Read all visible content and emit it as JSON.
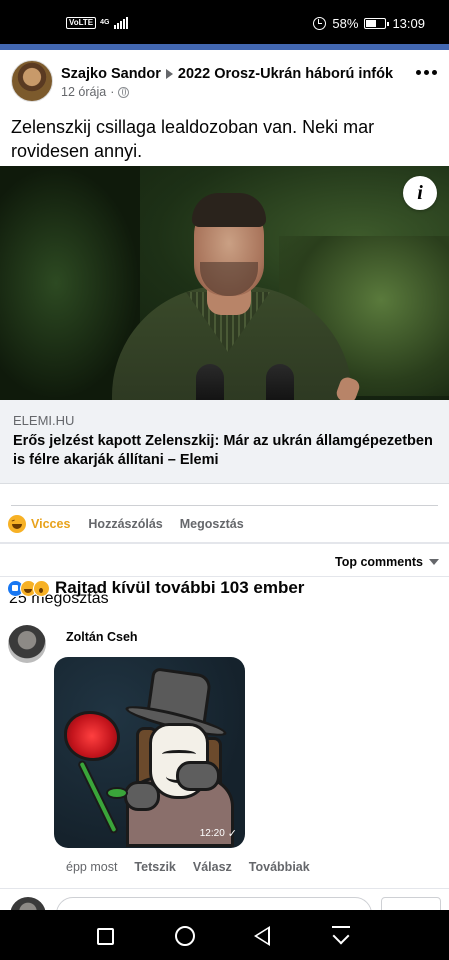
{
  "status_bar": {
    "volte": "VoLTE",
    "network": "4G",
    "battery_text": "58%",
    "battery_level": 0.58,
    "time": "13:09"
  },
  "post": {
    "author": "Szajko Sandor",
    "group": "2022 Orosz-Ukrán háború infók",
    "time": "12 órája",
    "visibility_icon": "globe-icon",
    "text": "Zelenszkij csillaga lealdozoban van. Neki mar rovidesen annyi.",
    "link": {
      "domain": "ELEMI.HU",
      "title": "Erős jelzést kapott Zelenszkij: Már az ukrán államgépezetben is félre akarják állítani – Elemi"
    },
    "info_icon": "i"
  },
  "actions": {
    "reaction_label": "Vicces",
    "comment_label": "Hozzászólás",
    "share_label": "Megosztás"
  },
  "comments_sort": "Top comments",
  "summary": {
    "reactions_text": "Rajtad kívül további 103 ember",
    "shares_text": "25 megosztás"
  },
  "comment": {
    "author": "Zoltán Cseh",
    "sticker_time": "12:20",
    "time": "épp most",
    "like_label": "Tetszik",
    "reply_label": "Válasz",
    "more_label": "Továbbiak"
  },
  "colors": {
    "facebook_blue": "#4267b2",
    "haha_yellow": "#e8a21b",
    "secondary_text": "#65676b"
  }
}
